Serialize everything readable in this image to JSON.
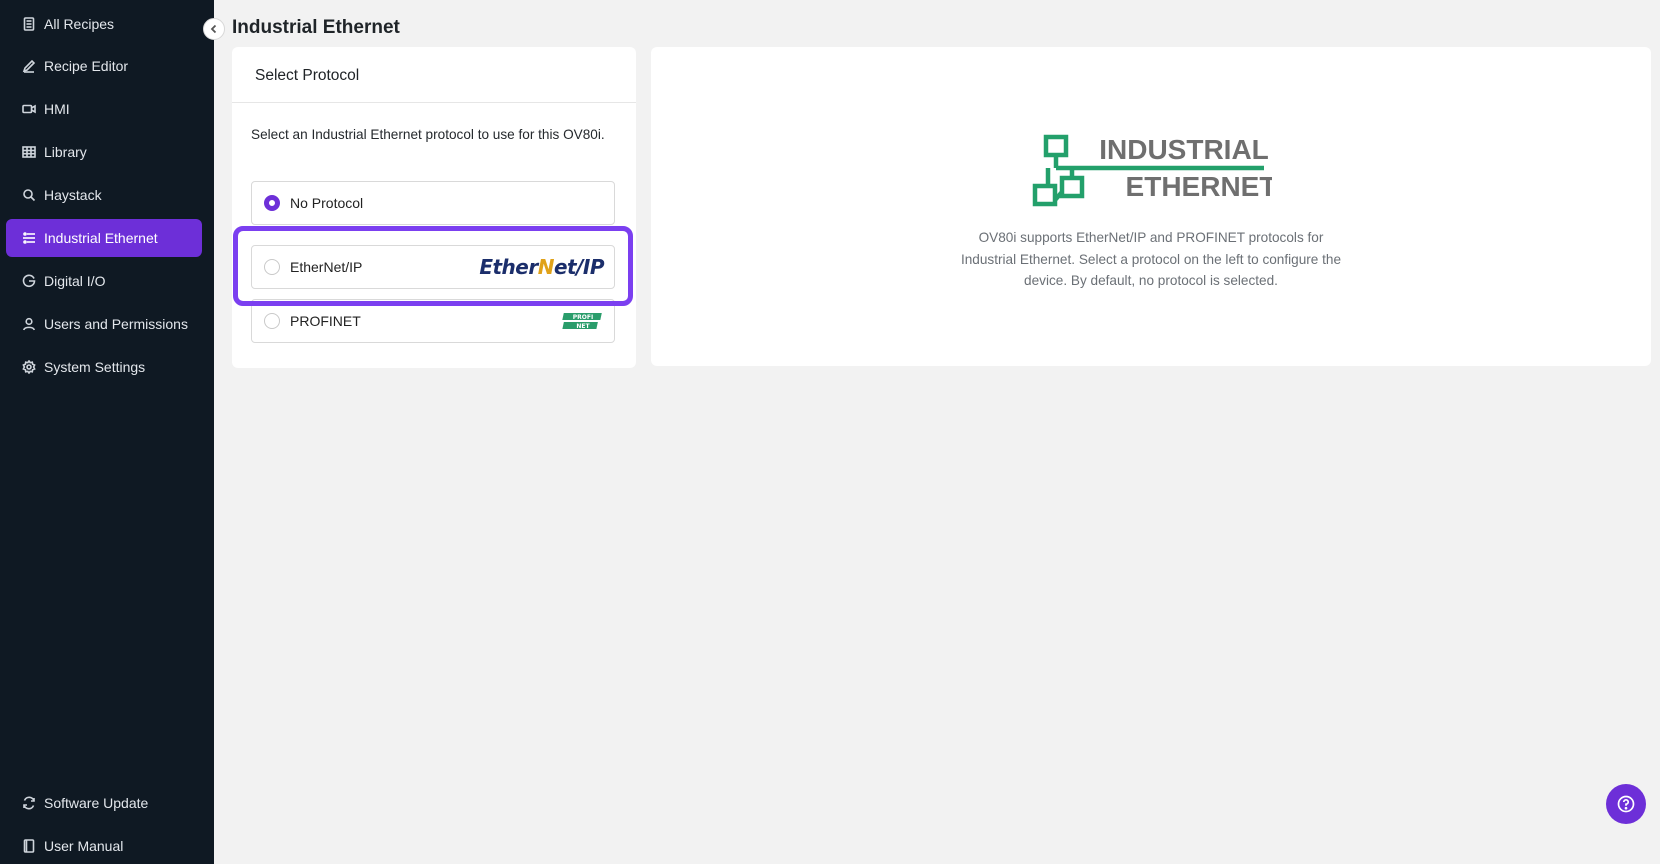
{
  "sidebar": {
    "items": [
      {
        "label": "All Recipes",
        "icon": "document-icon"
      },
      {
        "label": "Recipe Editor",
        "icon": "pencil-icon"
      },
      {
        "label": "HMI",
        "icon": "video-icon"
      },
      {
        "label": "Library",
        "icon": "grid-icon"
      },
      {
        "label": "Haystack",
        "icon": "search-icon"
      },
      {
        "label": "Industrial Ethernet",
        "icon": "network-icon",
        "active": true
      },
      {
        "label": "Digital I/O",
        "icon": "digital-io-icon"
      },
      {
        "label": "Users and Permissions",
        "icon": "user-icon"
      },
      {
        "label": "System Settings",
        "icon": "gear-icon"
      }
    ],
    "bottom_items": [
      {
        "label": "Software Update",
        "icon": "refresh-icon"
      },
      {
        "label": "User Manual",
        "icon": "book-icon"
      }
    ]
  },
  "header": {
    "title": "Industrial Ethernet"
  },
  "protocol_panel": {
    "title": "Select Protocol",
    "description": "Select an Industrial Ethernet protocol to use for this OV80i.",
    "options": [
      {
        "label": "No Protocol",
        "selected": true
      },
      {
        "label": "EtherNet/IP",
        "selected": false,
        "logo_text": "EtherNet/IP"
      },
      {
        "label": "PROFINET",
        "selected": false,
        "logo_text": "PROFI NET"
      }
    ]
  },
  "info_panel": {
    "logo_line1": "INDUSTRIAL",
    "logo_line2": "ETHERNET",
    "text": "OV80i supports EtherNet/IP and PROFINET protocols for Industrial Ethernet. Select a protocol on the left to configure the device. By default, no protocol is selected."
  },
  "colors": {
    "accent": "#6d2fd8",
    "sidebar_bg": "#0f1923",
    "ie_green": "#23a06b",
    "ie_gray": "#6f6f6f"
  },
  "help_button": {
    "icon": "help-icon"
  }
}
